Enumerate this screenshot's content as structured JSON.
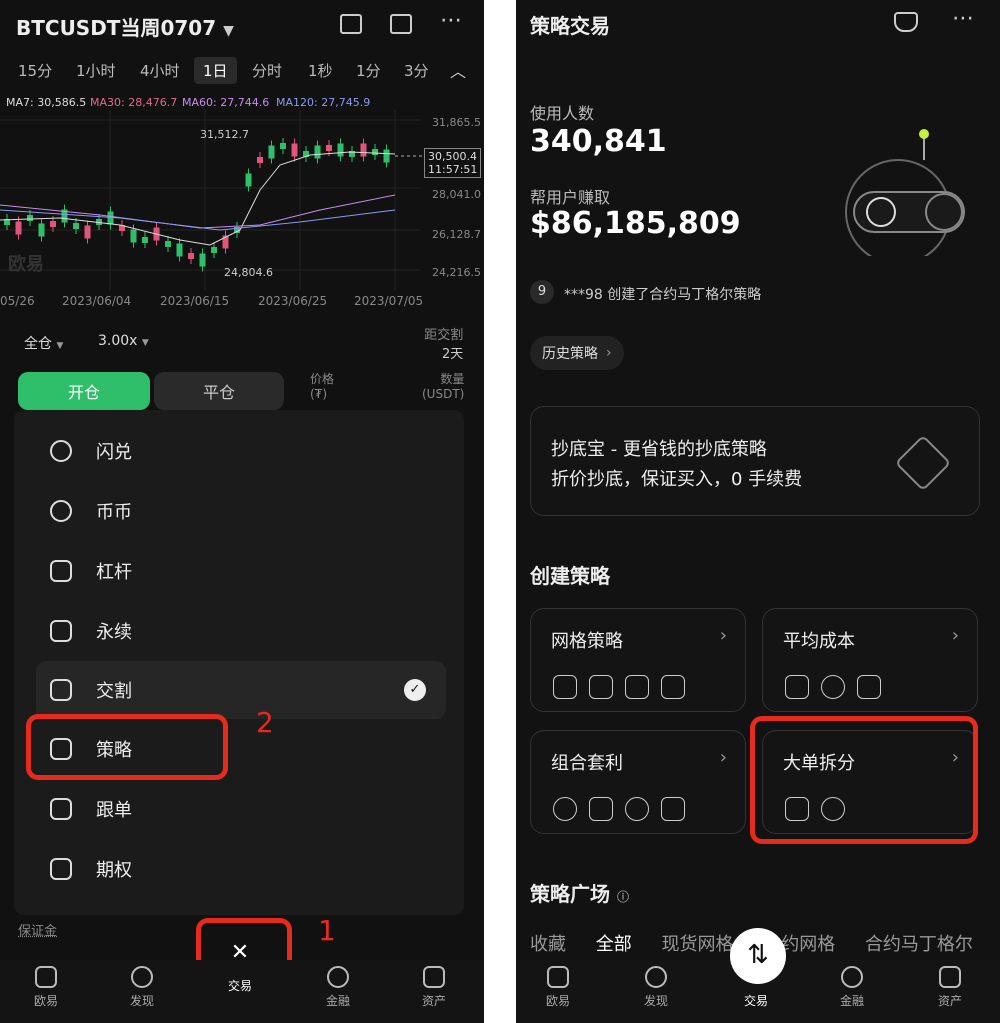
{
  "left": {
    "symbol": "BTCUSDT当周0707",
    "timeframes": [
      "15分",
      "1小时",
      "4小时",
      "1日",
      "分时",
      "1秒",
      "1分",
      "3分"
    ],
    "selected_tf": "1日",
    "ma": {
      "ma7": "MA7: 30,586.5",
      "ma30": "MA30: 28,476.7",
      "ma60": "MA60: 27,744.6",
      "ma120": "MA120: 27,745.9"
    },
    "price_axis": [
      "31,865.5",
      "30,500.4",
      "11:57:51",
      "28,041.0",
      "26,128.7",
      "24,216.5"
    ],
    "high_label": "31,512.7",
    "low_label": "24,804.6",
    "watermark": "欧易",
    "dates": [
      "05/26",
      "2023/06/04",
      "2023/06/15",
      "2023/06/25",
      "2023/07/05"
    ],
    "margin_mode": "全仓",
    "leverage": "3.00x",
    "delivery": {
      "label": "距交割",
      "value": "2天"
    },
    "open_label": "开仓",
    "close_label": "平仓",
    "price_col": {
      "l1": "价格",
      "l2": "(₮)"
    },
    "qty_col": {
      "l1": "数量",
      "l2": "(USDT)"
    },
    "menu": [
      "闪兑",
      "币币",
      "杠杆",
      "永续",
      "交割",
      "策略",
      "跟单",
      "期权"
    ],
    "margin_text": "保证金",
    "nav": [
      "欧易",
      "发现",
      "交易",
      "金融",
      "资产"
    ],
    "annot1": "1",
    "annot2": "2"
  },
  "right": {
    "title": "策略交易",
    "users_label": "使用人数",
    "users_value": "340,841",
    "earn_label": "帮用户赚取",
    "earn_value": "$86,185,809",
    "ticker_badge": "9",
    "ticker_text": "***98 创建了合约马丁格尔策略",
    "history_btn": "历史策略",
    "promo_line1": "抄底宝 - 更省钱的抄底策略",
    "promo_line2": "折价抄底，保证买入，0 手续费",
    "create_title": "创建策略",
    "tiles": [
      "网格策略",
      "平均成本",
      "组合套利",
      "大单拆分"
    ],
    "square_title": "策略广场",
    "square_tabs": [
      "收藏",
      "全部",
      "现货网格",
      "合约网格",
      "合约马丁格尔"
    ],
    "nav": [
      "欧易",
      "发现",
      "交易",
      "金融",
      "资产"
    ]
  }
}
